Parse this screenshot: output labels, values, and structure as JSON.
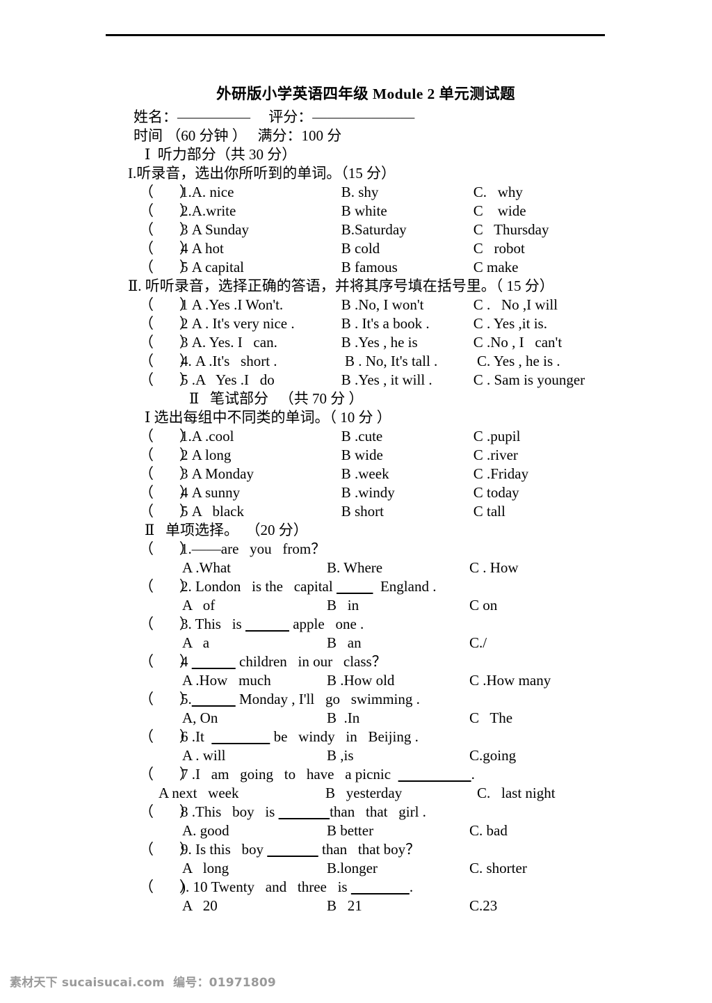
{
  "document": {
    "title": "外研版小学英语四年级 Module 2 单元测试题",
    "name_score_line": "姓名：—————     评分：———————",
    "time_line": "时间 （60 分钟 ）   满分：100 分"
  },
  "part1": {
    "header": "Ⅰ  听力部分（共 30 分）",
    "sectionI": {
      "heading": "I.听录音，选出你所听到的单词。（15 分）",
      "items": [
        {
          "paren": "（       ）",
          "num": "1.",
          "a": "A. nice",
          "b": "B. shy",
          "c": "C.   why"
        },
        {
          "paren": "（       ）",
          "num": "2.",
          "a": "A.write",
          "b": "B white",
          "c": "C    wide"
        },
        {
          "paren": "（       ）",
          "num": "3 ",
          "a": "A Sunday",
          "b": "B.Saturday",
          "c": "C   Thursday"
        },
        {
          "paren": "（       ）",
          "num": "4 ",
          "a": "A hot",
          "b": "B cold",
          "c": "C   robot"
        },
        {
          "paren": "（       ）",
          "num": "5 ",
          "a": "A capital",
          "b": "B famous",
          "c": "C make"
        }
      ]
    },
    "sectionII": {
      "heading": "Ⅱ. 听听录音，选择正确的答语，并将其序号填在括号里。（ 15 分）",
      "items": [
        {
          "paren": "（       ）",
          "num": "1 ",
          "a": "A .Yes .I Won't.",
          "b": "B .No, I won't",
          "c": "C .   No ,I will"
        },
        {
          "paren": "（       ）",
          "num": "2 ",
          "a": "A . It's very nice .",
          "b": "B . It's a book .",
          "c": "C . Yes ,it is."
        },
        {
          "paren": "（       ）",
          "num": "3 ",
          "a": "A. Yes. I   can.",
          "b": "B .Yes , he is",
          "c": "C .No , I   can't"
        },
        {
          "paren": "（       ）",
          "num": "4. ",
          "a": "A .It's   short .",
          "b": "B . No, It's tall .",
          "c": "C. Yes , he is ."
        },
        {
          "paren": "（       ）",
          "num": "5 ",
          "a": ".A   Yes .I   do",
          "b": "B .Yes , it will .",
          "c": "C . Sam is younger"
        }
      ]
    }
  },
  "part2": {
    "header": "Ⅱ   笔试部分   （共 70 分 ）",
    "sectionI": {
      "heading": "Ⅰ 选出每组中不同类的单词。（ 10 分 ）",
      "items": [
        {
          "paren": "（       ）",
          "num": "1.",
          "a": "A .cool",
          "b": "B .cute",
          "c": "C .pupil"
        },
        {
          "paren": "（       ）",
          "num": "2 ",
          "a": "A long",
          "b": "B wide",
          "c": "C .river"
        },
        {
          "paren": "（       ）",
          "num": "3 ",
          "a": "A Monday",
          "b": "B .week",
          "c": "C .Friday"
        },
        {
          "paren": "（       ）",
          "num": "4 ",
          "a": "A sunny",
          "b": "B .windy",
          "c": "C today"
        },
        {
          "paren": "（       ）",
          "num": "5 ",
          "a": "A   black",
          "b": "B short",
          "c": "C tall"
        }
      ]
    },
    "sectionII": {
      "heading": "Ⅱ   单项选择。  （20 分）",
      "items": [
        {
          "paren": "（       ）",
          "stem": "1.——are   you   from？",
          "style": "wide",
          "a": "A .What",
          "b": "B. Where",
          "c": "C . How"
        },
        {
          "paren": "（       ）",
          "stem_pre": "2. London   is the   capital ",
          "stem_blank": "          ",
          "stem_post": "  England .",
          "style": "wide",
          "a": "A   of",
          "b": "B   in",
          "c": "C on"
        },
        {
          "paren": "（       ）",
          "stem_pre": "3. This   is ",
          "stem_blank": "            ",
          "stem_post": " apple   one .",
          "style": "wide",
          "a": "A   a",
          "b": "B   an",
          "c": "C./"
        },
        {
          "paren": "（       ）",
          "stem_pre": "4 ",
          "stem_blank": "            ",
          "stem_post": " children   in our   class？",
          "style": "wide",
          "a": "A .How   much",
          "b": "B .How old",
          "c": "C .How many"
        },
        {
          "paren": "（       ）",
          "stem_pre": "5.",
          "stem_blank": "            ",
          "stem_post": " Monday , I'll   go   swimming .",
          "style": "wide",
          "a": "A, On",
          "b": "B  .In",
          "c": "C   The"
        },
        {
          "paren": "（       ）",
          "stem_pre": "6 .It  ",
          "stem_blank": "                ",
          "stem_post": " be   windy   in   Beijing .",
          "style": "wide",
          "a": "A . will",
          "b": "B ,is",
          "c": "C.going"
        },
        {
          "paren": "（       ）",
          "stem_pre": "7 .I   am   going   to   have   a picnic  ",
          "stem_blank": "                    ",
          "stem_post": ".",
          "style": "narrow",
          "a": "A next   week",
          "b": "B   yesterday",
          "c": "C.   last night"
        },
        {
          "paren": "（       ）",
          "stem_pre": "8 .This   boy   is ",
          "stem_blank": "              ",
          "stem_post": "than   that   girl .",
          "style": "wide",
          "a": "A. good",
          "b": "B better",
          "c": "C. bad"
        },
        {
          "paren": "（       ）",
          "stem_pre": "9. Is this   boy ",
          "stem_blank": "              ",
          "stem_post": " than   that boy？",
          "style": "wide",
          "a": "A   long",
          "b": "B.longer",
          "c": "C. shorter"
        },
        {
          "paren": "（       ）",
          "stem_pre": "). 10 Twenty   and   three   is ",
          "stem_blank": "                ",
          "stem_post": ".",
          "style": "wide",
          "a": "A   20",
          "b": "B   21",
          "c": "C.23"
        }
      ]
    }
  },
  "footer": {
    "text": "素材天下 sucaisucai.com  编号：01971809"
  }
}
